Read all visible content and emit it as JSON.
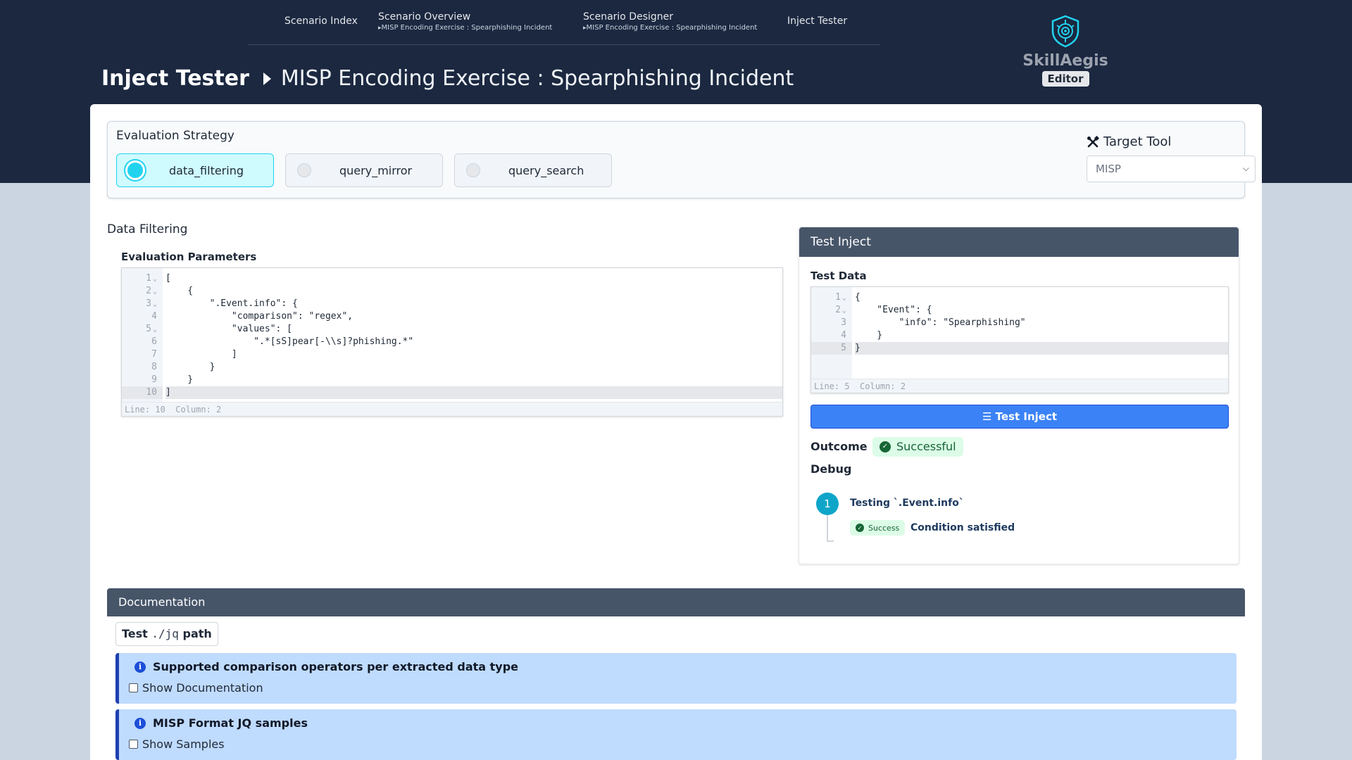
{
  "nav": {
    "items": [
      {
        "label": "Scenario Index",
        "sub": ""
      },
      {
        "label": "Scenario Overview",
        "sub": "MISP Encoding Exercise : Spearphishing Incident"
      },
      {
        "label": "Scenario Designer",
        "sub": "MISP Encoding Exercise : Spearphishing Incident"
      },
      {
        "label": "Inject Tester",
        "sub": ""
      }
    ]
  },
  "brand": {
    "name": "SkillAegis",
    "badge": "Editor"
  },
  "page": {
    "title": "Inject Tester",
    "subtitle": "MISP Encoding Exercise : Spearphishing Incident"
  },
  "strategy": {
    "label": "Evaluation Strategy",
    "options": [
      {
        "label": "data_filtering",
        "selected": true
      },
      {
        "label": "query_mirror",
        "selected": false
      },
      {
        "label": "query_search",
        "selected": false
      }
    ]
  },
  "target_tool": {
    "label": "Target Tool",
    "value": "MISP"
  },
  "data_filtering": {
    "heading": "Data Filtering",
    "params_label": "Evaluation Parameters",
    "line_numbers": [
      "1",
      "2",
      "3",
      "4",
      "5",
      "6",
      "7",
      "8",
      "9",
      "10"
    ],
    "code": [
      "[",
      "    {",
      "        \".Event.info\": {",
      "            \"comparison\": \"regex\",",
      "            \"values\": [",
      "                \".*[sS]pear[-\\\\s]?phishing.*\"",
      "            ]",
      "        }",
      "    }",
      "]"
    ],
    "status": "Line: 10  Column: 2"
  },
  "test_inject": {
    "header": "Test Inject",
    "data_label": "Test Data",
    "line_numbers": [
      "1",
      "2",
      "3",
      "4",
      "5"
    ],
    "code": [
      "{",
      "    \"Event\": {",
      "        \"info\": \"Spearphishing\"",
      "    }",
      "}"
    ],
    "status": "Line: 5  Column: 2",
    "button_label": "Test Inject",
    "outcome_label": "Outcome",
    "outcome_value": "Successful",
    "debug_label": "Debug",
    "steps": [
      {
        "number": "1",
        "title": "Testing `.Event.info`",
        "badge": "Success",
        "message": "Condition satisfied"
      }
    ]
  },
  "documentation": {
    "header": "Documentation",
    "tab_prefix": "Test",
    "tab_mono": "./jq",
    "tab_suffix": "path",
    "boxes": [
      {
        "title": "Supported comparison operators per extracted data type",
        "checkbox": "Show Documentation"
      },
      {
        "title": "MISP Format JQ samples",
        "checkbox": "Show Samples"
      }
    ]
  },
  "colors": {
    "header_bg": "#1b2840",
    "accent": "#22d3ee",
    "primary": "#3b82f6",
    "success": "#166534"
  }
}
